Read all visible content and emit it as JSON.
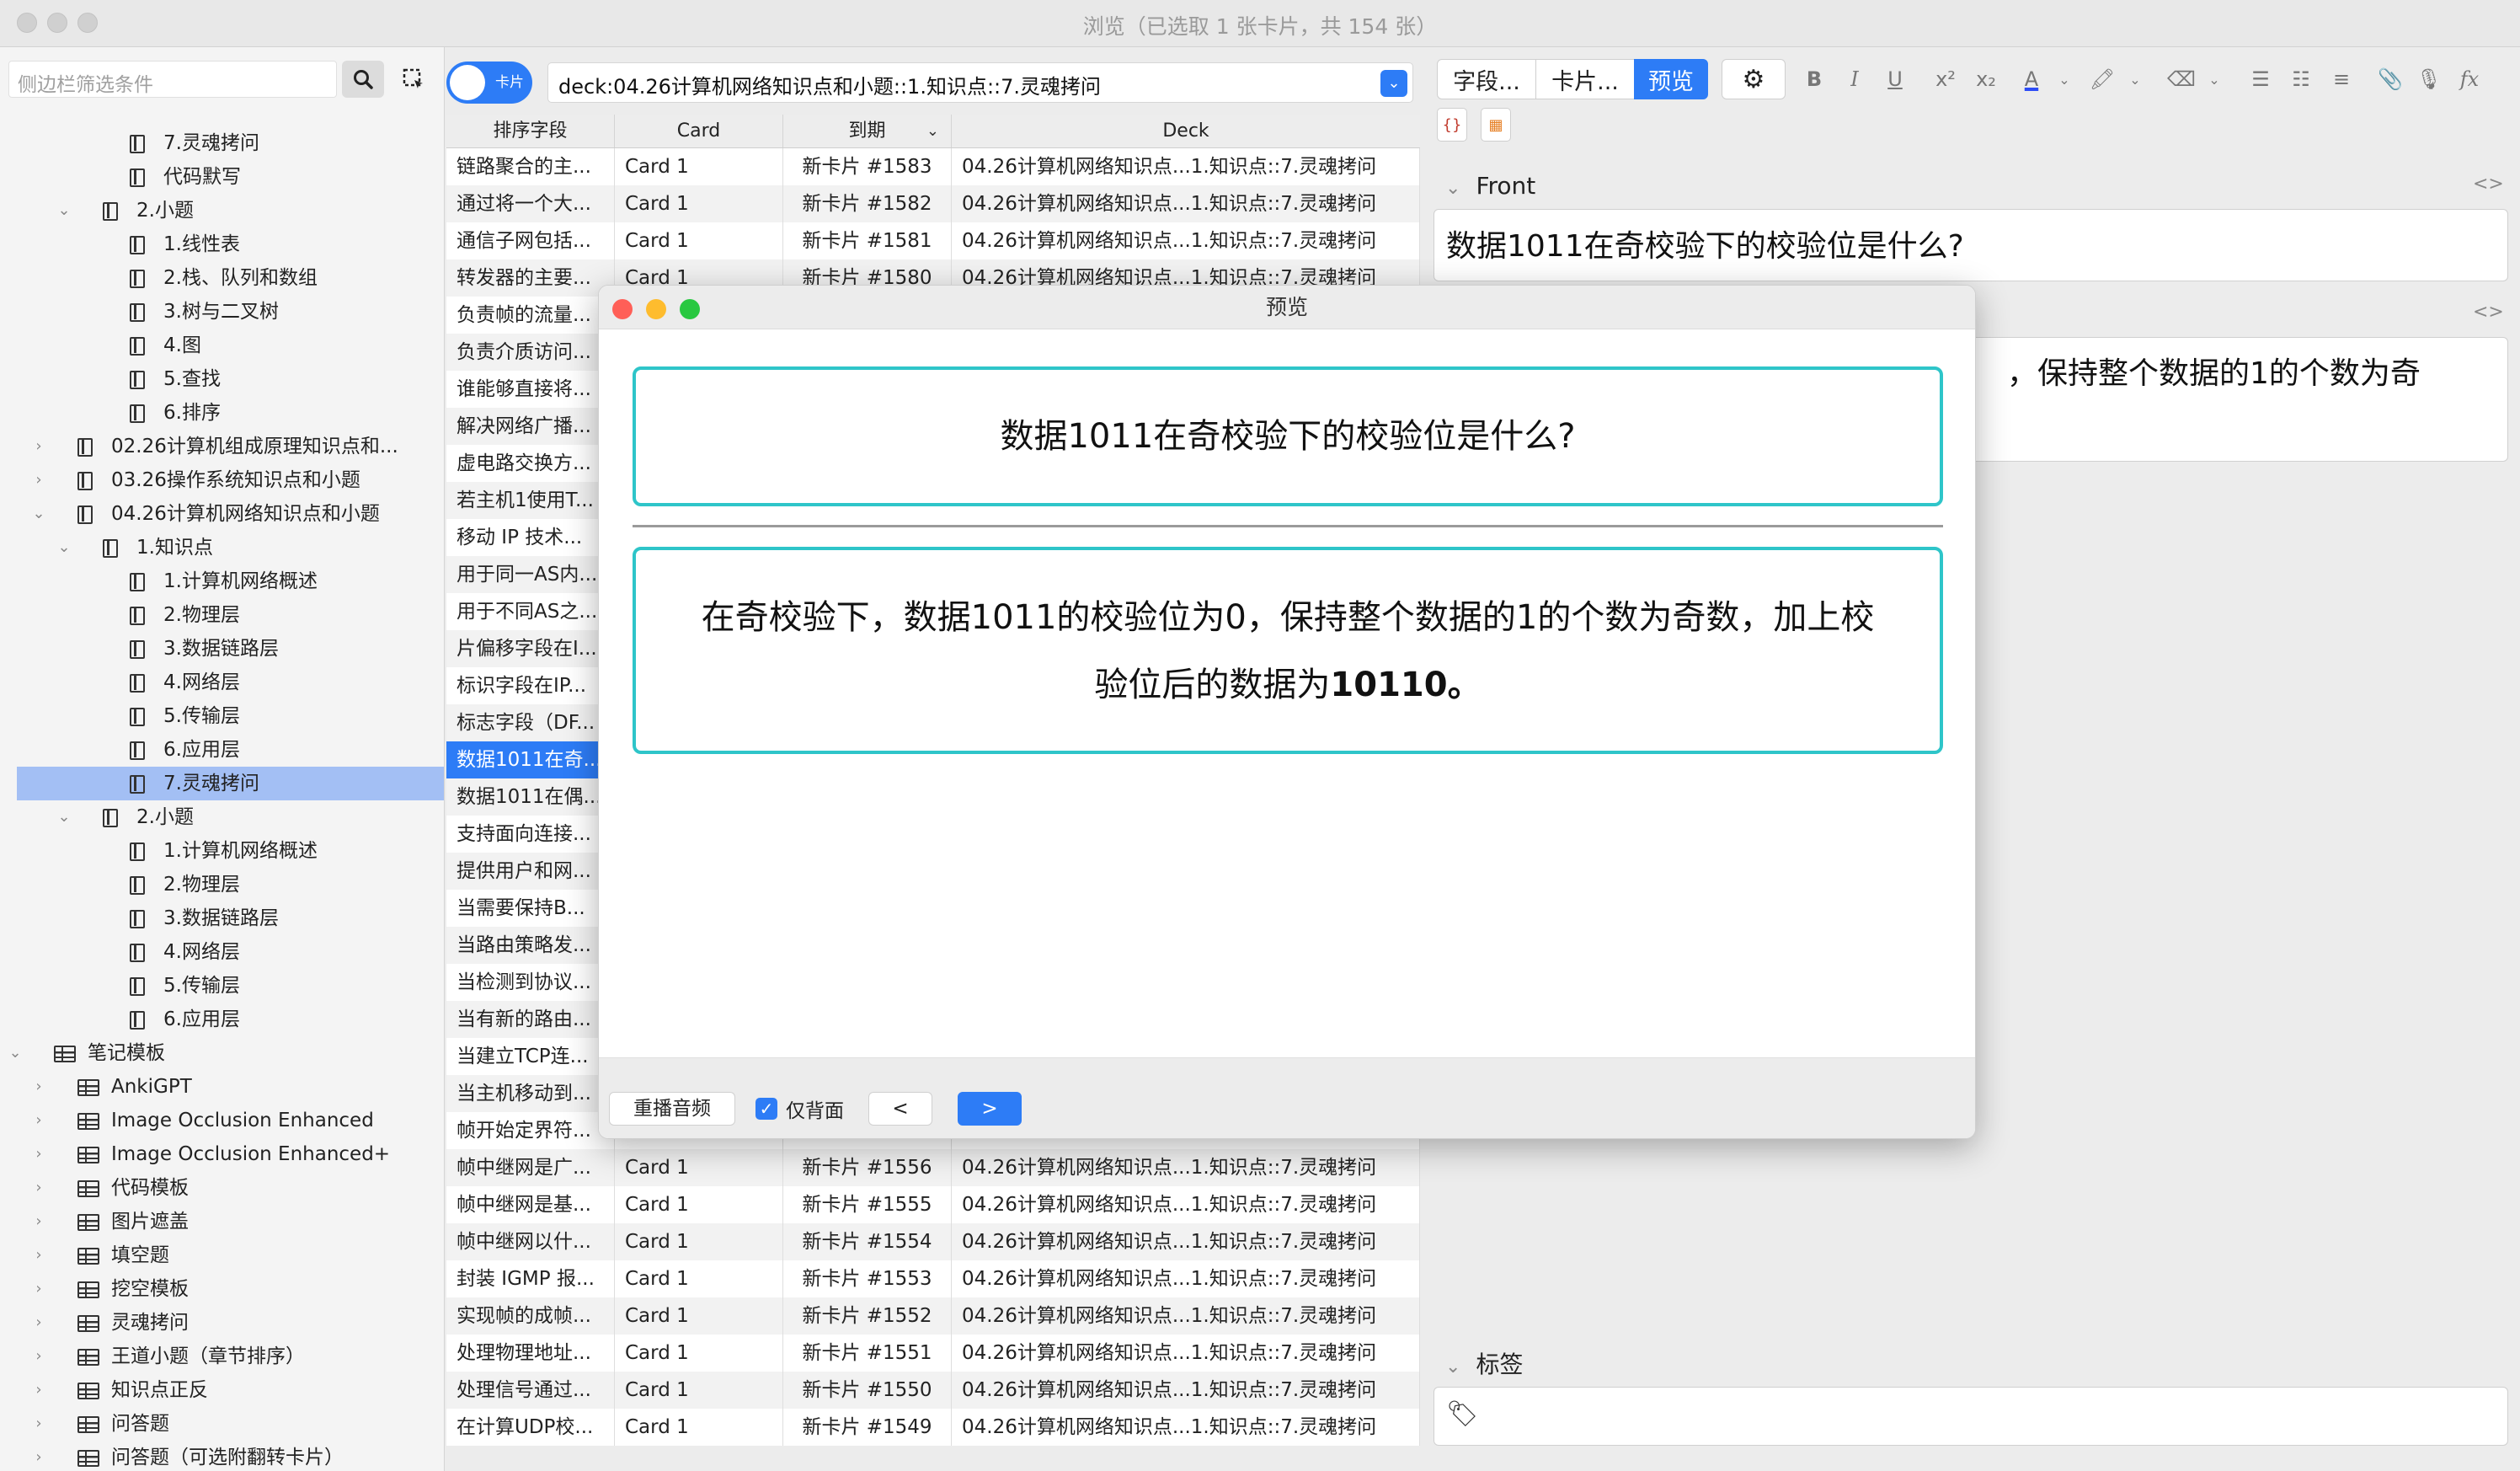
{
  "window": {
    "title": "浏览（已选取 1 张卡片，共 154 张）"
  },
  "sidebar": {
    "search_placeholder": "侧边栏筛选条件",
    "tree": [
      {
        "label": "7.灵魂拷问",
        "level": 4,
        "type": "deck",
        "chev": ""
      },
      {
        "label": "代码默写",
        "level": 4,
        "type": "deck",
        "chev": ""
      },
      {
        "label": "2.小题",
        "level": 3,
        "type": "deck",
        "chev": "v"
      },
      {
        "label": "1.线性表",
        "level": 4,
        "type": "deck",
        "chev": ""
      },
      {
        "label": "2.栈、队列和数组",
        "level": 4,
        "type": "deck",
        "chev": ""
      },
      {
        "label": "3.树与二叉树",
        "level": 4,
        "type": "deck",
        "chev": ""
      },
      {
        "label": "4.图",
        "level": 4,
        "type": "deck",
        "chev": ""
      },
      {
        "label": "5.查找",
        "level": 4,
        "type": "deck",
        "chev": ""
      },
      {
        "label": "6.排序",
        "level": 4,
        "type": "deck",
        "chev": ""
      },
      {
        "label": "02.26计算机组成原理知识点和...",
        "level": 2,
        "type": "deck",
        "chev": ">"
      },
      {
        "label": "03.26操作系统知识点和小题",
        "level": 2,
        "type": "deck",
        "chev": ">"
      },
      {
        "label": "04.26计算机网络知识点和小题",
        "level": 2,
        "type": "deck",
        "chev": "v"
      },
      {
        "label": "1.知识点",
        "level": 3,
        "type": "deck",
        "chev": "v"
      },
      {
        "label": "1.计算机网络概述",
        "level": 4,
        "type": "deck",
        "chev": ""
      },
      {
        "label": "2.物理层",
        "level": 4,
        "type": "deck",
        "chev": ""
      },
      {
        "label": "3.数据链路层",
        "level": 4,
        "type": "deck",
        "chev": ""
      },
      {
        "label": "4.网络层",
        "level": 4,
        "type": "deck",
        "chev": ""
      },
      {
        "label": "5.传输层",
        "level": 4,
        "type": "deck",
        "chev": ""
      },
      {
        "label": "6.应用层",
        "level": 4,
        "type": "deck",
        "chev": ""
      },
      {
        "label": "7.灵魂拷问",
        "level": 4,
        "type": "deck",
        "chev": "",
        "selected": true
      },
      {
        "label": "2.小题",
        "level": 3,
        "type": "deck",
        "chev": "v"
      },
      {
        "label": "1.计算机网络概述",
        "level": 4,
        "type": "deck",
        "chev": ""
      },
      {
        "label": "2.物理层",
        "level": 4,
        "type": "deck",
        "chev": ""
      },
      {
        "label": "3.数据链路层",
        "level": 4,
        "type": "deck",
        "chev": ""
      },
      {
        "label": "4.网络层",
        "level": 4,
        "type": "deck",
        "chev": ""
      },
      {
        "label": "5.传输层",
        "level": 4,
        "type": "deck",
        "chev": ""
      },
      {
        "label": "6.应用层",
        "level": 4,
        "type": "deck",
        "chev": ""
      },
      {
        "label": "笔记模板",
        "level": 1,
        "type": "note",
        "chev": "v"
      },
      {
        "label": "AnkiGPT",
        "level": 2,
        "type": "note",
        "chev": ">"
      },
      {
        "label": "Image Occlusion Enhanced",
        "level": 2,
        "type": "note",
        "chev": ">"
      },
      {
        "label": "Image Occlusion Enhanced+",
        "level": 2,
        "type": "note",
        "chev": ">"
      },
      {
        "label": "代码模板",
        "level": 2,
        "type": "note",
        "chev": ">"
      },
      {
        "label": "图片遮盖",
        "level": 2,
        "type": "note",
        "chev": ">"
      },
      {
        "label": "填空题",
        "level": 2,
        "type": "note",
        "chev": ">"
      },
      {
        "label": "挖空模板",
        "level": 2,
        "type": "note",
        "chev": ">"
      },
      {
        "label": "灵魂拷问",
        "level": 2,
        "type": "note",
        "chev": ">"
      },
      {
        "label": "王道小题（章节排序）",
        "level": 2,
        "type": "note",
        "chev": ">"
      },
      {
        "label": "知识点正反",
        "level": 2,
        "type": "note",
        "chev": ">"
      },
      {
        "label": "问答题",
        "level": 2,
        "type": "note",
        "chev": ">"
      },
      {
        "label": "问答题（可选附翻转卡片）",
        "level": 2,
        "type": "note",
        "chev": ">"
      }
    ]
  },
  "toolbar": {
    "toggle_label": "卡片",
    "search_value": "deck:04.26计算机网络知识点和小题::1.知识点::7.灵魂拷问"
  },
  "table": {
    "headers": [
      "排序字段",
      "Card",
      "到期",
      "Deck"
    ],
    "rows": [
      [
        "链路聚合的主...",
        "Card 1",
        "新卡片 #1583",
        "04.26计算机网络知识点...1.知识点::7.灵魂拷问"
      ],
      [
        "通过将一个大...",
        "Card 1",
        "新卡片 #1582",
        "04.26计算机网络知识点...1.知识点::7.灵魂拷问"
      ],
      [
        "通信子网包括...",
        "Card 1",
        "新卡片 #1581",
        "04.26计算机网络知识点...1.知识点::7.灵魂拷问"
      ],
      [
        "转发器的主要...",
        "Card 1",
        "新卡片 #1580",
        "04.26计算机网络知识点...1.知识点::7.灵魂拷问"
      ],
      [
        "负责帧的流量...",
        "",
        "",
        ""
      ],
      [
        "负责介质访问...",
        "",
        "",
        ""
      ],
      [
        "谁能够直接将...",
        "",
        "",
        ""
      ],
      [
        "解决网络广播...",
        "",
        "",
        ""
      ],
      [
        "虚电路交换方...",
        "",
        "",
        ""
      ],
      [
        "若主机1使用T...",
        "",
        "",
        ""
      ],
      [
        "移动 IP 技术...",
        "",
        "",
        ""
      ],
      [
        "用于同一AS内...",
        "",
        "",
        ""
      ],
      [
        "用于不同AS之...",
        "",
        "",
        ""
      ],
      [
        "片偏移字段在I...",
        "",
        "",
        ""
      ],
      [
        "标识字段在IP...",
        "",
        "",
        ""
      ],
      [
        "标志字段（DF...",
        "",
        "",
        ""
      ],
      [
        "数据1011在奇...",
        "",
        "",
        ""
      ],
      [
        "数据1011在偶...",
        "",
        "",
        ""
      ],
      [
        "支持面向连接...",
        "",
        "",
        ""
      ],
      [
        "提供用户和网...",
        "",
        "",
        ""
      ],
      [
        "当需要保持B...",
        "",
        "",
        ""
      ],
      [
        "当路由策略发...",
        "",
        "",
        ""
      ],
      [
        "当检测到协议...",
        "",
        "",
        ""
      ],
      [
        "当有新的路由...",
        "",
        "",
        ""
      ],
      [
        "当建立TCP连...",
        "",
        "",
        ""
      ],
      [
        "当主机移动到...",
        "",
        "",
        ""
      ],
      [
        "帧开始定界符...",
        "",
        "",
        ""
      ],
      [
        "帧中继网是广...",
        "Card 1",
        "新卡片 #1556",
        "04.26计算机网络知识点...1.知识点::7.灵魂拷问"
      ],
      [
        "帧中继网是基...",
        "Card 1",
        "新卡片 #1555",
        "04.26计算机网络知识点...1.知识点::7.灵魂拷问"
      ],
      [
        "帧中继网以什...",
        "Card 1",
        "新卡片 #1554",
        "04.26计算机网络知识点...1.知识点::7.灵魂拷问"
      ],
      [
        "封装 IGMP 报...",
        "Card 1",
        "新卡片 #1553",
        "04.26计算机网络知识点...1.知识点::7.灵魂拷问"
      ],
      [
        "实现帧的成帧...",
        "Card 1",
        "新卡片 #1552",
        "04.26计算机网络知识点...1.知识点::7.灵魂拷问"
      ],
      [
        "处理物理地址...",
        "Card 1",
        "新卡片 #1551",
        "04.26计算机网络知识点...1.知识点::7.灵魂拷问"
      ],
      [
        "处理信号通过...",
        "Card 1",
        "新卡片 #1550",
        "04.26计算机网络知识点...1.知识点::7.灵魂拷问"
      ],
      [
        "在计算UDP校...",
        "Card 1",
        "新卡片 #1549",
        "04.26计算机网络知识点...1.知识点::7.灵魂拷问"
      ]
    ],
    "selected_row": 16
  },
  "editor": {
    "fields_button": "字段...",
    "cards_button": "卡片...",
    "preview_button": "预览",
    "front_label": "Front",
    "front_value": "数据1011在奇校验下的校验位是什么?",
    "back_partial": "，保持整个数据的1的个数为奇",
    "tags_label": "标签"
  },
  "preview": {
    "title": "预览",
    "question": "数据1011在奇校验下的校验位是什么?",
    "answer_line1": "在奇校验下，数据1011的校验位为0，保持整个数据的1的个数为奇数，加上校",
    "answer_line2_prefix": "验位后的数据为",
    "answer_bold": "10110。",
    "replay_button": "重播音频",
    "back_only_label": "仅背面",
    "prev_button": "<",
    "next_button": ">",
    "accent_color": "#2ec5c9"
  }
}
